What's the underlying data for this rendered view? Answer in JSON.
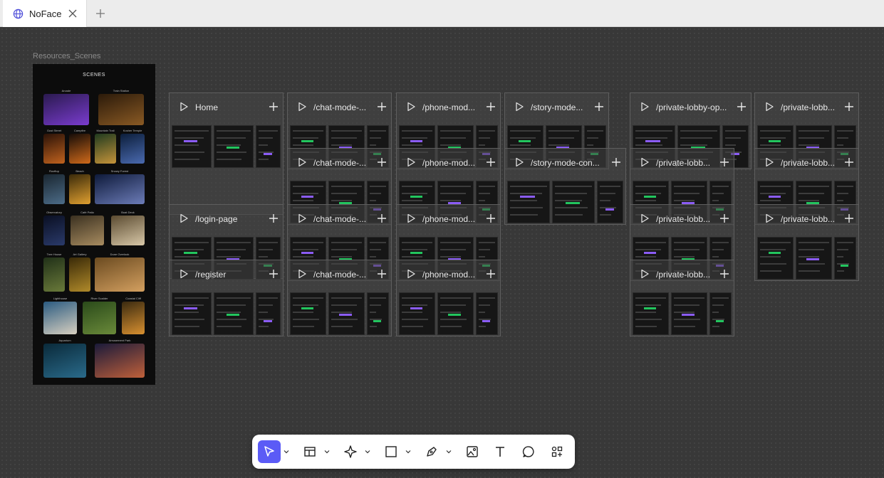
{
  "tab": {
    "title": "NoFace"
  },
  "canvas": {
    "resource_board": {
      "label": "Resources_Scenes",
      "title": "SCENES",
      "scenes": [
        "Arcade",
        "Train Station",
        "Gust Street",
        "Campfire",
        "Mountain Trail",
        "Kosher Temple",
        "Rooftop",
        "Beach",
        "Snowy Forest",
        "Observatory",
        "Café Patio",
        "Boat Deck",
        "Tree House",
        "Art Gallery",
        "Dune Overlook",
        "Lighthouse",
        "River Scalder",
        "Coastal Cliff",
        "Aquarium",
        "Amusement Park"
      ]
    },
    "flows": [
      {
        "title": "Home"
      },
      {
        "title": "/chat-mode-..."
      },
      {
        "title": "/phone-mod..."
      },
      {
        "title": "/story-mode..."
      },
      {
        "title": "/private-lobby-op..."
      },
      {
        "title": "/private-lobb..."
      },
      {
        "title": "/chat-mode-..."
      },
      {
        "title": "/phone-mod..."
      },
      {
        "title": "/story-mode-con..."
      },
      {
        "title": "/private-lobb..."
      },
      {
        "title": "/private-lobb..."
      },
      {
        "title": "/login-page"
      },
      {
        "title": "/chat-mode-..."
      },
      {
        "title": "/phone-mod..."
      },
      {
        "title": "/private-lobb..."
      },
      {
        "title": "/private-lobb..."
      },
      {
        "title": "/register"
      },
      {
        "title": "/chat-mode-..."
      },
      {
        "title": "/phone-mod..."
      },
      {
        "title": "/private-lobb..."
      }
    ]
  },
  "toolbar": {
    "tools": [
      "select-tool",
      "frame-tool",
      "component-tool",
      "rectangle-tool",
      "pen-tool",
      "image-tool",
      "text-tool",
      "comment-tool",
      "plugins-tool"
    ],
    "accent": "#5b5bf6"
  }
}
